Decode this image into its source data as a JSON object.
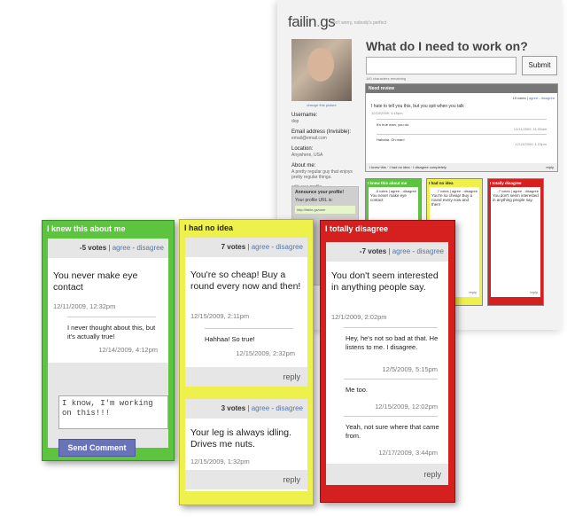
{
  "site": {
    "brand_main": "failin",
    "brand_dot": ".",
    "brand_tail": "gs",
    "tagline": "don't worry, nobody's perfect"
  },
  "profile": {
    "avatar_caption": "change this picture",
    "username_label": "Username:",
    "username": "dop",
    "email_label": "Email address (Invisible):",
    "email": "email@email.com",
    "location_label": "Location:",
    "location": "Anywhere, USA",
    "about_label": "About me:",
    "about": "A pretty regular guy that enjoys pretty regular things.",
    "edit_link": "edit your profile"
  },
  "announce": {
    "title": "Announce your profile!",
    "text": "Your profile URL is:",
    "url": "http://failin.gs/user"
  },
  "question": {
    "title": "What do I need to work on?",
    "submit": "Submit",
    "remaining": "140 characters remaining"
  },
  "review": {
    "header": "Need review",
    "votes": "19 votes",
    "agree": "agree",
    "disagree": "disagree",
    "text": "I hate to tell you this, but you spit when you talk",
    "date": "12/10/2009, 4:15pm",
    "reply1": "It's true man, you do.",
    "reply1_date": "12/11/2009, 11:05am",
    "reply2": "Hahaha. Oh man!",
    "reply2_date": "12/13/2009, 1:23pm",
    "footer": "I knew this · I had no idea · I disagree completely",
    "reply": "reply"
  },
  "mini_cards": [
    {
      "title": "I knew this about me",
      "votes": "-5 votes | agree - disagree",
      "text": "You never make eye contact"
    },
    {
      "title": "I had no idea",
      "votes": "7 votes | agree - disagree",
      "text": "You're so cheap! Buy a round every now and then!"
    },
    {
      "title": "I totally disagree",
      "votes": "-7 votes | agree - disagree",
      "text": "You don't seem interested in anything people say."
    }
  ],
  "cards": {
    "knew": {
      "title": "I knew this about me",
      "votes": "-5 votes",
      "agree": "agree",
      "disagree": "disagree",
      "comment": "You never make eye contact",
      "date": "12/11/2009, 12:32pm",
      "reply_text": "I never thought about this, but it's actually true!",
      "reply_date": "12/14/2009, 4:12pm",
      "input_value": "I know, I'm working on this!!!",
      "send_label": "Send Comment"
    },
    "noidea": {
      "title": "I had no idea",
      "c1": {
        "votes": "7 votes",
        "agree": "agree",
        "disagree": "disagree",
        "comment": "You're so cheap! Buy a round every now and then!",
        "date": "12/15/2009, 2:11pm",
        "reply_text": "Hahhaa! So true!",
        "reply_date": "12/15/2009, 2:32pm",
        "reply_label": "reply"
      },
      "c2": {
        "votes": "3 votes",
        "agree": "agree",
        "disagree": "disagree",
        "comment": "Your leg is always idling. Drives me nuts.",
        "date": "12/15/2009, 1:32pm",
        "reply_label": "reply"
      }
    },
    "disagree": {
      "title": "I totally disagree",
      "votes": "-7 votes",
      "agree": "agree",
      "disagree": "disagree",
      "comment": "You don't seem interested in anything people say.",
      "date": "12/1/2009, 2:02pm",
      "r1_text": "Hey, he's not so bad at that. He listens to me. I disagree.",
      "r1_date": "12/5/2009, 5:15pm",
      "r2_text": "Me too.",
      "r2_date": "12/15/2009, 12:02pm",
      "r3_text": "Yeah, not sure where that came from.",
      "r3_date": "12/17/2009, 3:44pm",
      "reply_label": "reply"
    }
  },
  "colors": {
    "green": "#5cc43e",
    "yellow": "#eef04c",
    "red": "#d61f1f",
    "link": "#5577aa",
    "button": "#6a73b8"
  }
}
